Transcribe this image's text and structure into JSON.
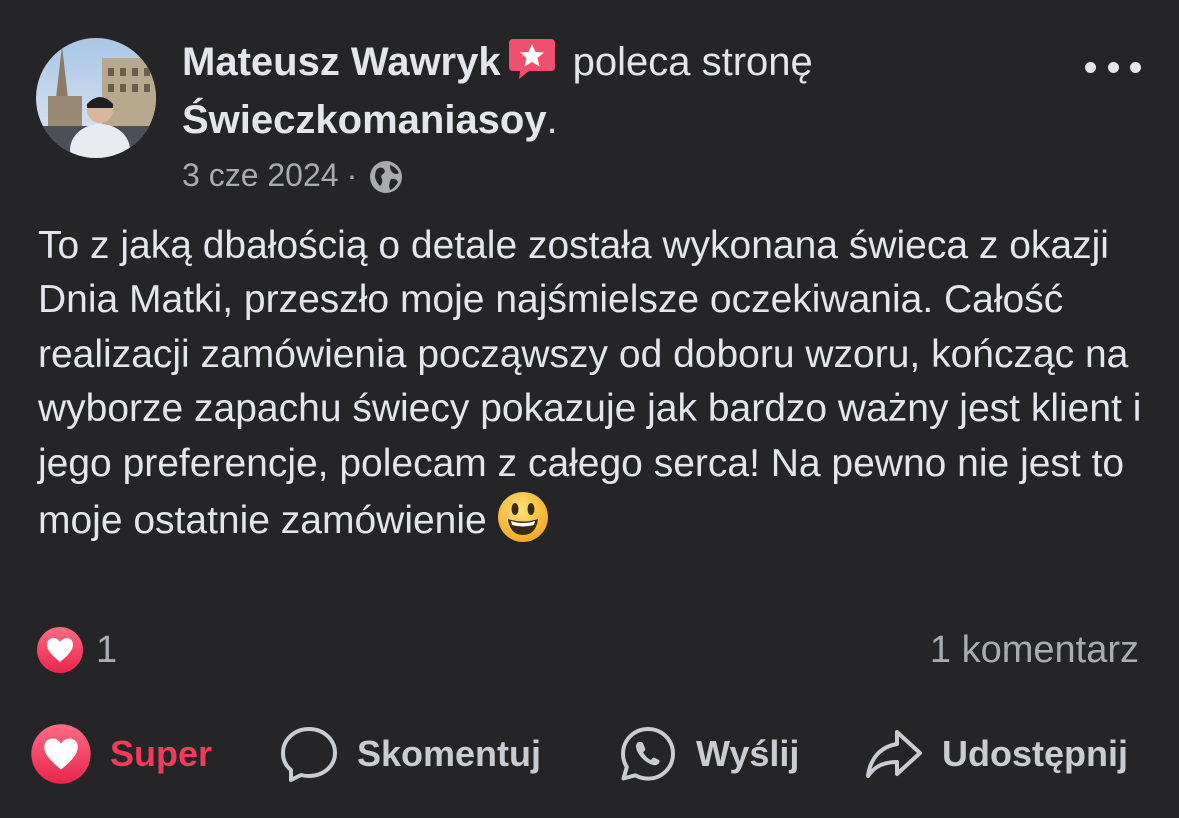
{
  "post": {
    "author": "Mateusz Wawryk",
    "recommendation_text": "poleca stronę",
    "page_name": "Świeczkomaniasoy",
    "page_name_suffix": ".",
    "date": "3 cze 2024",
    "meta_separator": "·",
    "privacy_icon": "globe-icon",
    "body_text": "To z jaką dbałością o detale została wykonana świeca z okazji Dnia Matki, przeszło moje najśmielsze oczekiwania. Całość realizacji zamówienia począwszy od doboru wzoru, kończąc na wyborze zapachu świecy pokazuje jak bardzo ważny jest klient i jego preferencje, polecam z całego serca! Na pewno nie jest to moje ostatnie zamówienie",
    "body_emoji": "smiley-emoji-icon"
  },
  "engagement": {
    "reaction_icon": "love-reaction-icon",
    "reaction_count": "1",
    "comment_count_label": "1 komentarz"
  },
  "actions": {
    "super_label": "Super",
    "comment_label": "Skomentuj",
    "send_label": "Wyślij",
    "share_label": "Udostępnij"
  },
  "colors": {
    "background": "#252527",
    "text_primary": "#e4e6eb",
    "text_secondary": "#a8abb0",
    "love_accent": "#f23b5b",
    "recommend_badge": "#f0506e"
  }
}
